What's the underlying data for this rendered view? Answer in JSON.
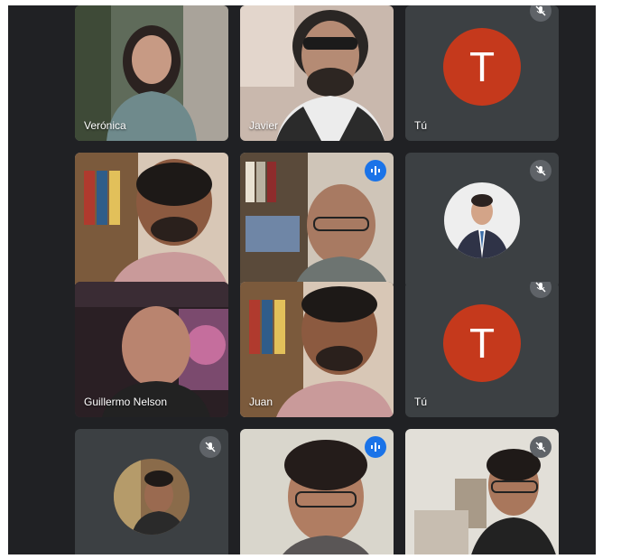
{
  "participants": [
    {
      "name": "Verónica"
    },
    {
      "name": "Javier"
    },
    {
      "name": "Tú",
      "initial": "T"
    },
    {
      "name": ""
    },
    {
      "name": ""
    },
    {
      "name": ""
    },
    {
      "name": "Guillermo Nelson"
    },
    {
      "name": "Juan"
    },
    {
      "name": "Tú",
      "initial": "T"
    },
    {
      "name": ""
    },
    {
      "name": ""
    },
    {
      "name": ""
    }
  ],
  "colors": {
    "background": "#202124",
    "tile": "#3c4043",
    "avatar_red": "#c5391c",
    "speaking_blue": "#1a73e8",
    "mic_off_gray": "#5f6368"
  },
  "icons": {
    "mic_off": "mic-off-icon",
    "speaking": "audio-level-icon"
  }
}
